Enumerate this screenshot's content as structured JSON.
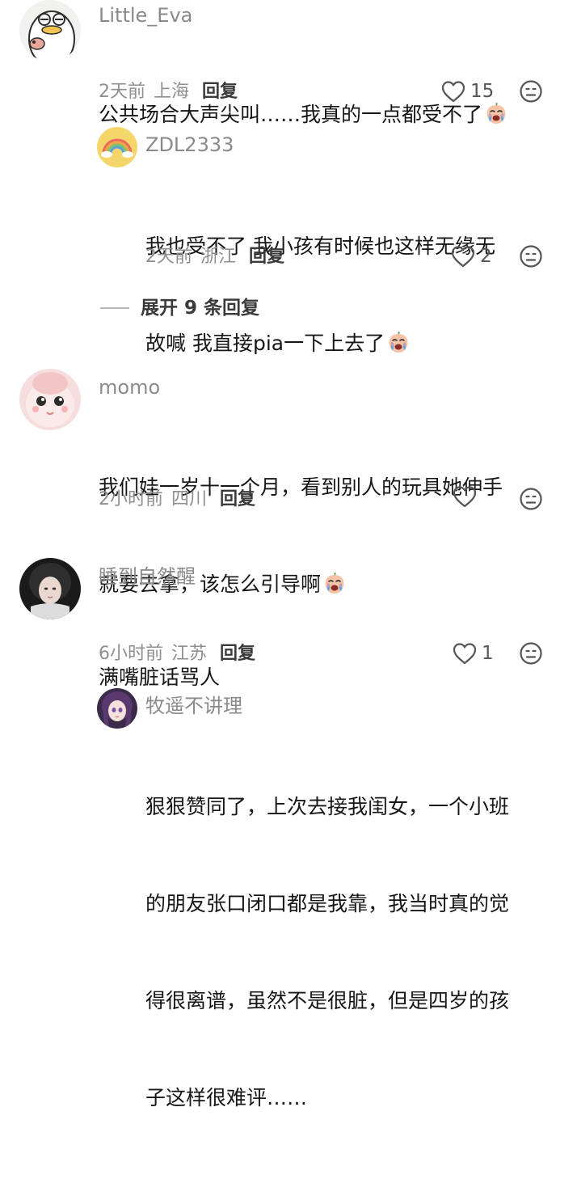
{
  "comments": [
    {
      "username": "Little_Eva",
      "text_lines": [
        "公共场合大声尖叫……我真的一点都受不了"
      ],
      "time": "2天前",
      "region": "上海",
      "reply_label": "回复",
      "likes": "15",
      "replies": [
        {
          "username": "ZDL2333",
          "text_lines": [
            "我也受不了 我小孩有时候也这样无缘无",
            "故喊 我直接pia一下上去了"
          ],
          "time": "2天前",
          "region": "浙江",
          "reply_label": "回复",
          "likes": "2"
        }
      ],
      "expand_label": "展开 9 条回复"
    },
    {
      "username": "momo",
      "text_lines": [
        "我们娃一岁十一个月，看到别人的玩具她伸手",
        "就要去拿，该怎么引导啊"
      ],
      "time": "2小时前",
      "region": "四川",
      "reply_label": "回复",
      "likes": ""
    },
    {
      "username": "睡到自然醒",
      "text_lines": [
        "满嘴脏话骂人"
      ],
      "time": "6小时前",
      "region": "江苏",
      "reply_label": "回复",
      "likes": "1",
      "replies": [
        {
          "username": "牧遥不讲理",
          "text_lines": [
            "狠狠赞同了，上次去接我闺女，一个小班",
            "的朋友张口闭口都是我靠，我当时真的觉",
            "得很离谱，虽然不是很脏，但是四岁的孩",
            "子这样很难评……"
          ]
        }
      ]
    }
  ],
  "icons": {
    "like": "heart-outline-icon",
    "dislike": "sad-face-icon",
    "emoji": "crying-face-emoji"
  },
  "colors": {
    "username": "#8a8a8a",
    "text": "#161616",
    "meta": "#8f8f8f",
    "reply": "#3a3a3a"
  }
}
